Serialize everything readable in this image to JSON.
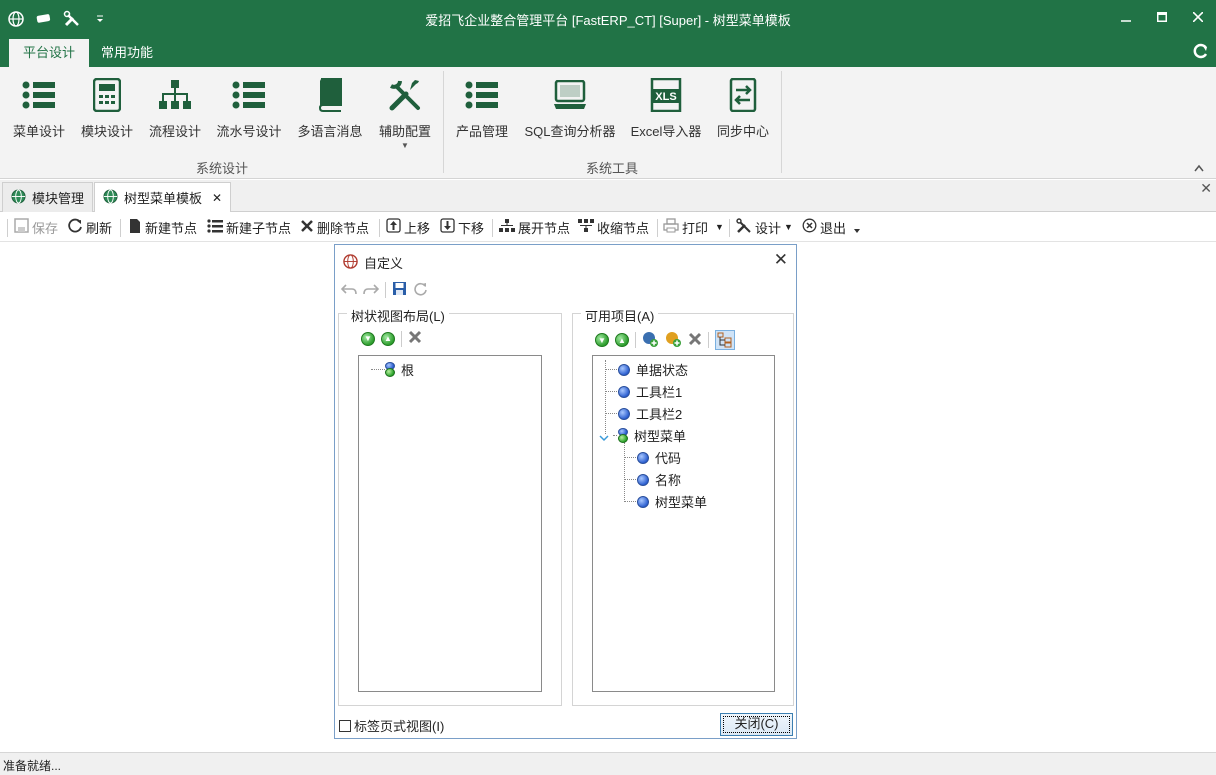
{
  "window": {
    "title": "爱招飞企业整合管理平台 [FastERP_CT] [Super] - 树型菜单模板",
    "controls": [
      "minimize",
      "maximize",
      "close"
    ]
  },
  "ribbon": {
    "tabs": [
      {
        "label": "平台设计",
        "active": true
      },
      {
        "label": "常用功能",
        "active": false
      }
    ],
    "groups": [
      {
        "label": "系统设计",
        "buttons": [
          {
            "label": "菜单设计",
            "icon": "list-icon"
          },
          {
            "label": "模块设计",
            "icon": "module-icon"
          },
          {
            "label": "流程设计",
            "icon": "flow-icon"
          },
          {
            "label": "流水号设计",
            "icon": "list-icon"
          },
          {
            "label": "多语言消息",
            "icon": "book-icon"
          },
          {
            "label": "辅助配置",
            "icon": "tools-icon"
          }
        ]
      },
      {
        "label": "系统工具",
        "buttons": [
          {
            "label": "产品管理",
            "icon": "list-icon"
          },
          {
            "label": "SQL查询分析器",
            "icon": "computer-icon"
          },
          {
            "label": "Excel导入器",
            "icon": "excel-icon"
          },
          {
            "label": "同步中心",
            "icon": "sync-icon"
          }
        ]
      }
    ]
  },
  "doc_tabs": [
    {
      "label": "模块管理",
      "active": false
    },
    {
      "label": "树型菜单模板",
      "active": true,
      "close": "✕"
    }
  ],
  "toolbar": {
    "save": "保存",
    "refresh": "刷新",
    "new_node": "新建节点",
    "new_child": "新建子节点",
    "delete_node": "删除节点",
    "move_up": "上移",
    "move_down": "下移",
    "expand": "展开节点",
    "collapse": "收缩节点",
    "print": "打印",
    "design": "设计",
    "exit": "退出"
  },
  "dialog": {
    "title": "自定义",
    "left_panel": {
      "legend": "树状视图布局(L)",
      "nodes": [
        {
          "label": "根"
        }
      ]
    },
    "right_panel": {
      "legend": "可用项目(A)",
      "nodes": [
        {
          "label": "单据状态"
        },
        {
          "label": "工具栏1"
        },
        {
          "label": "工具栏2"
        },
        {
          "label": "树型菜单",
          "expanded": true,
          "children": [
            {
              "label": "代码"
            },
            {
              "label": "名称"
            },
            {
              "label": "树型菜单"
            }
          ]
        }
      ]
    },
    "checkbox_label": "标签页式视图(I)",
    "close_button": "关闭(C)"
  },
  "status": {
    "text": "准备就绪..."
  },
  "colors": {
    "accent": "#217346",
    "dialog_border": "#7a9fc8"
  }
}
